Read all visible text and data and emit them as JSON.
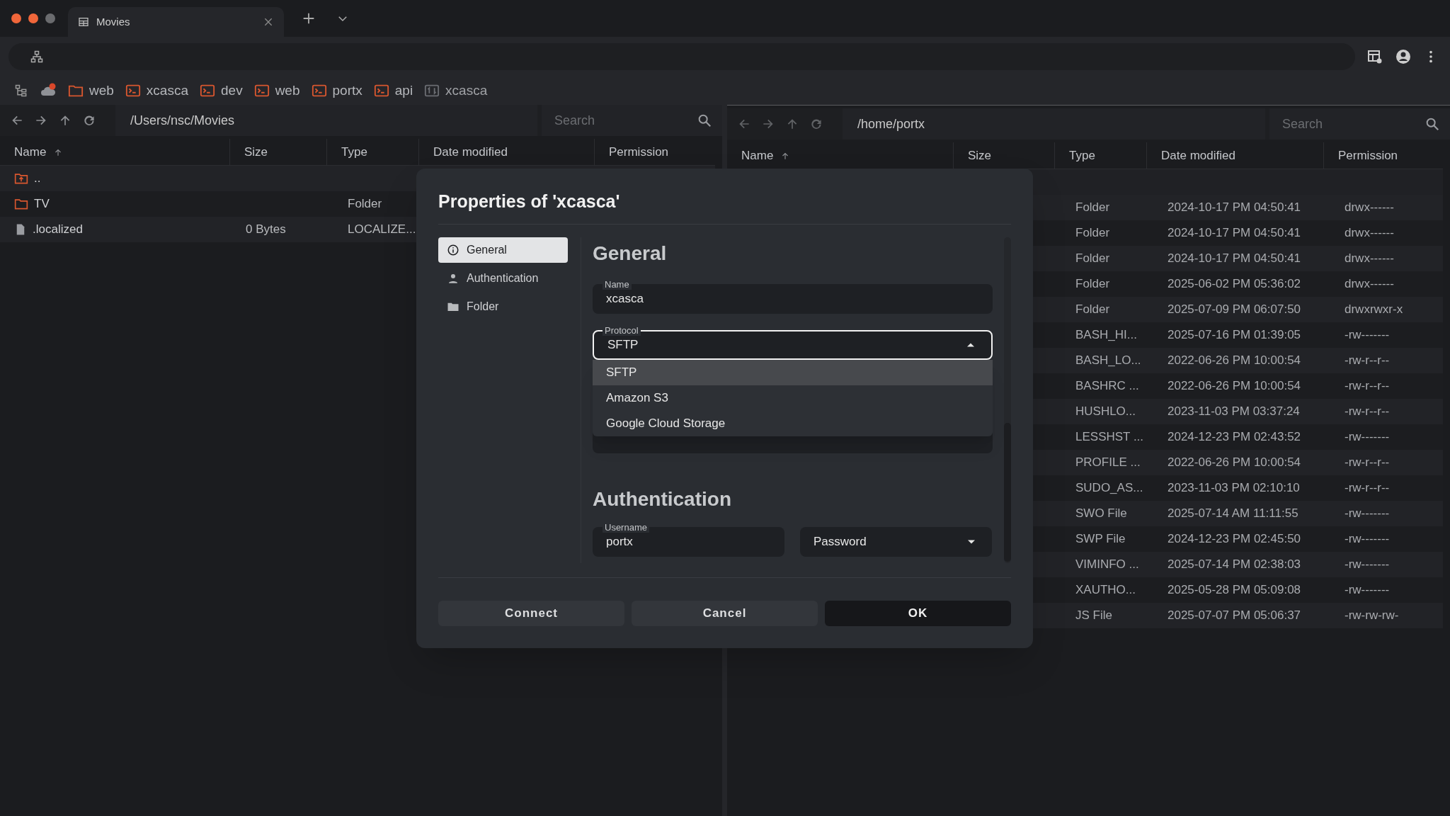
{
  "window": {
    "tab": {
      "title": "Movies"
    }
  },
  "bookmarks": [
    {
      "label": "web",
      "kind": "folder"
    },
    {
      "label": "xcasca",
      "kind": "terminal"
    },
    {
      "label": "dev",
      "kind": "terminal"
    },
    {
      "label": "web",
      "kind": "terminal"
    },
    {
      "label": "portx",
      "kind": "terminal"
    },
    {
      "label": "api",
      "kind": "terminal"
    },
    {
      "label": "xcasca",
      "kind": "sync"
    }
  ],
  "left_pane": {
    "path": "/Users/nsc/Movies",
    "search": {
      "placeholder": "Search"
    },
    "columns": [
      {
        "label": "Name",
        "sorted": true
      },
      {
        "label": "Size",
        "sorted": false
      },
      {
        "label": "Type",
        "sorted": false
      },
      {
        "label": "Date modified",
        "sorted": false
      },
      {
        "label": "Permission",
        "sorted": false
      }
    ],
    "rows": [
      {
        "kind": "parent",
        "name": ".."
      },
      {
        "kind": "folder",
        "name": "TV",
        "type": "Folder"
      },
      {
        "kind": "file",
        "name": ".localized",
        "size": "0 Bytes",
        "type": "LOCALIZE..."
      }
    ]
  },
  "right_pane": {
    "path": "/home/portx",
    "search": {
      "placeholder": "Search"
    },
    "columns": [
      {
        "label": "Name",
        "sorted": true
      },
      {
        "label": "Size",
        "sorted": false
      },
      {
        "label": "Type",
        "sorted": false
      },
      {
        "label": "Date modified",
        "sorted": false
      },
      {
        "label": "Permission",
        "sorted": false
      }
    ],
    "rows": [
      {
        "type": "Folder",
        "date": "2024-10-17 PM 04:50:41",
        "permission": "drwx------"
      },
      {
        "type": "Folder",
        "date": "2024-10-17 PM 04:50:41",
        "permission": "drwx------"
      },
      {
        "type": "Folder",
        "date": "2024-10-17 PM 04:50:41",
        "permission": "drwx------"
      },
      {
        "type": "Folder",
        "date": "2025-06-02 PM 05:36:02",
        "permission": "drwx------"
      },
      {
        "type": "Folder",
        "date": "2025-07-09 PM 06:07:50",
        "permission": "drwxrwxr-x"
      },
      {
        "type": "BASH_HI...",
        "date": "2025-07-16 PM 01:39:05",
        "permission": "-rw-------"
      },
      {
        "type": "BASH_LO...",
        "date": "2022-06-26 PM 10:00:54",
        "permission": "-rw-r--r--"
      },
      {
        "type": "BASHRC ...",
        "date": "2022-06-26 PM 10:00:54",
        "permission": "-rw-r--r--"
      },
      {
        "type": "HUSHLO...",
        "date": "2023-11-03 PM 03:37:24",
        "permission": "-rw-r--r--"
      },
      {
        "type": "LESSHST ...",
        "date": "2024-12-23 PM 02:43:52",
        "permission": "-rw-------"
      },
      {
        "type": "PROFILE ...",
        "date": "2022-06-26 PM 10:00:54",
        "permission": "-rw-r--r--"
      },
      {
        "type": "SUDO_AS...",
        "date": "2023-11-03 PM 02:10:10",
        "permission": "-rw-r--r--"
      },
      {
        "type": "SWO File",
        "date": "2025-07-14 AM 11:11:55",
        "permission": "-rw-------"
      },
      {
        "type": "SWP File",
        "date": "2024-12-23 PM 02:45:50",
        "permission": "-rw-------"
      },
      {
        "type": "VIMINFO ...",
        "date": "2025-07-14 PM 02:38:03",
        "permission": "-rw-------"
      },
      {
        "type": "XAUTHO...",
        "date": "2025-05-28 PM 05:09:08",
        "permission": "-rw-------"
      },
      {
        "type": "JS File",
        "date": "2025-07-07 PM 05:06:37",
        "permission": "-rw-rw-rw-"
      }
    ]
  },
  "dialog": {
    "title": "Properties of 'xcasca'",
    "nav": [
      {
        "label": "General",
        "kind": "info",
        "selected": true
      },
      {
        "label": "Authentication",
        "kind": "person",
        "selected": false
      },
      {
        "label": "Folder",
        "kind": "folder",
        "selected": false
      }
    ],
    "general_heading": "General",
    "name_field": {
      "label": "Name",
      "value": "xcasca"
    },
    "protocol_field": {
      "label": "Protocol",
      "value": "SFTP",
      "expanded": true,
      "options": [
        {
          "label": "SFTP",
          "selected": true
        },
        {
          "label": "Amazon S3",
          "selected": false
        },
        {
          "label": "Google Cloud Storage",
          "selected": false
        }
      ]
    },
    "auth_heading": "Authentication",
    "username_field": {
      "label": "Username",
      "value": "portx"
    },
    "auth_method": {
      "value": "Password"
    },
    "buttons": [
      {
        "label": "Connect",
        "kind": "secondary"
      },
      {
        "label": "Cancel",
        "kind": "secondary"
      },
      {
        "label": "OK",
        "kind": "primary"
      }
    ]
  }
}
